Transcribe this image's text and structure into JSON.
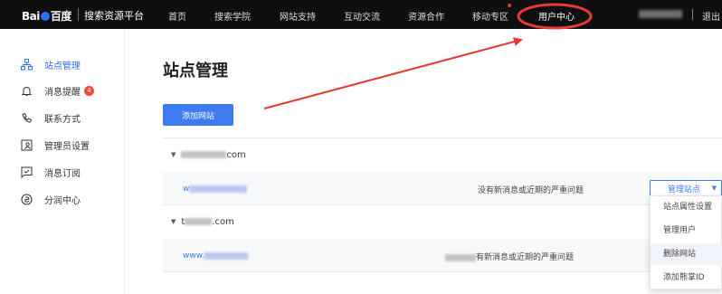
{
  "topbar": {
    "logo_text_left": "Bai",
    "logo_text_right": "百度",
    "platform_name": "搜索资源平台",
    "nav": [
      "首页",
      "搜索学院",
      "网站支持",
      "互动交流",
      "资源合作",
      "移动专区",
      "用户中心"
    ],
    "logout": "退出"
  },
  "sidebar": {
    "items": [
      {
        "label": "站点管理",
        "icon": "sitemap-icon"
      },
      {
        "label": "消息提醒",
        "icon": "bell-icon",
        "badge": "4"
      },
      {
        "label": "联系方式",
        "icon": "phone-icon"
      },
      {
        "label": "管理员设置",
        "icon": "admin-icon"
      },
      {
        "label": "消息订阅",
        "icon": "subscribe-icon"
      },
      {
        "label": "分润中心",
        "icon": "coin-icon"
      }
    ]
  },
  "main": {
    "title": "站点管理",
    "add_button": "添加网站",
    "groups": [
      {
        "name_suffix": "com",
        "site_prefix": "w",
        "message": "没有新消息或近期的严重问题"
      },
      {
        "name_prefix": "t",
        "name_suffix": ".com",
        "site_prefix": "www.",
        "message": "有新消息或近期的严重问题"
      }
    ],
    "manage_select": "管理站点",
    "manage_options": [
      "站点属性设置",
      "管理用户",
      "删除网站",
      "添加熊掌ID"
    ]
  },
  "colors": {
    "accent": "#3e7bf0",
    "annotation": "#e53935",
    "topbar_bg": "#0f0f0f"
  }
}
